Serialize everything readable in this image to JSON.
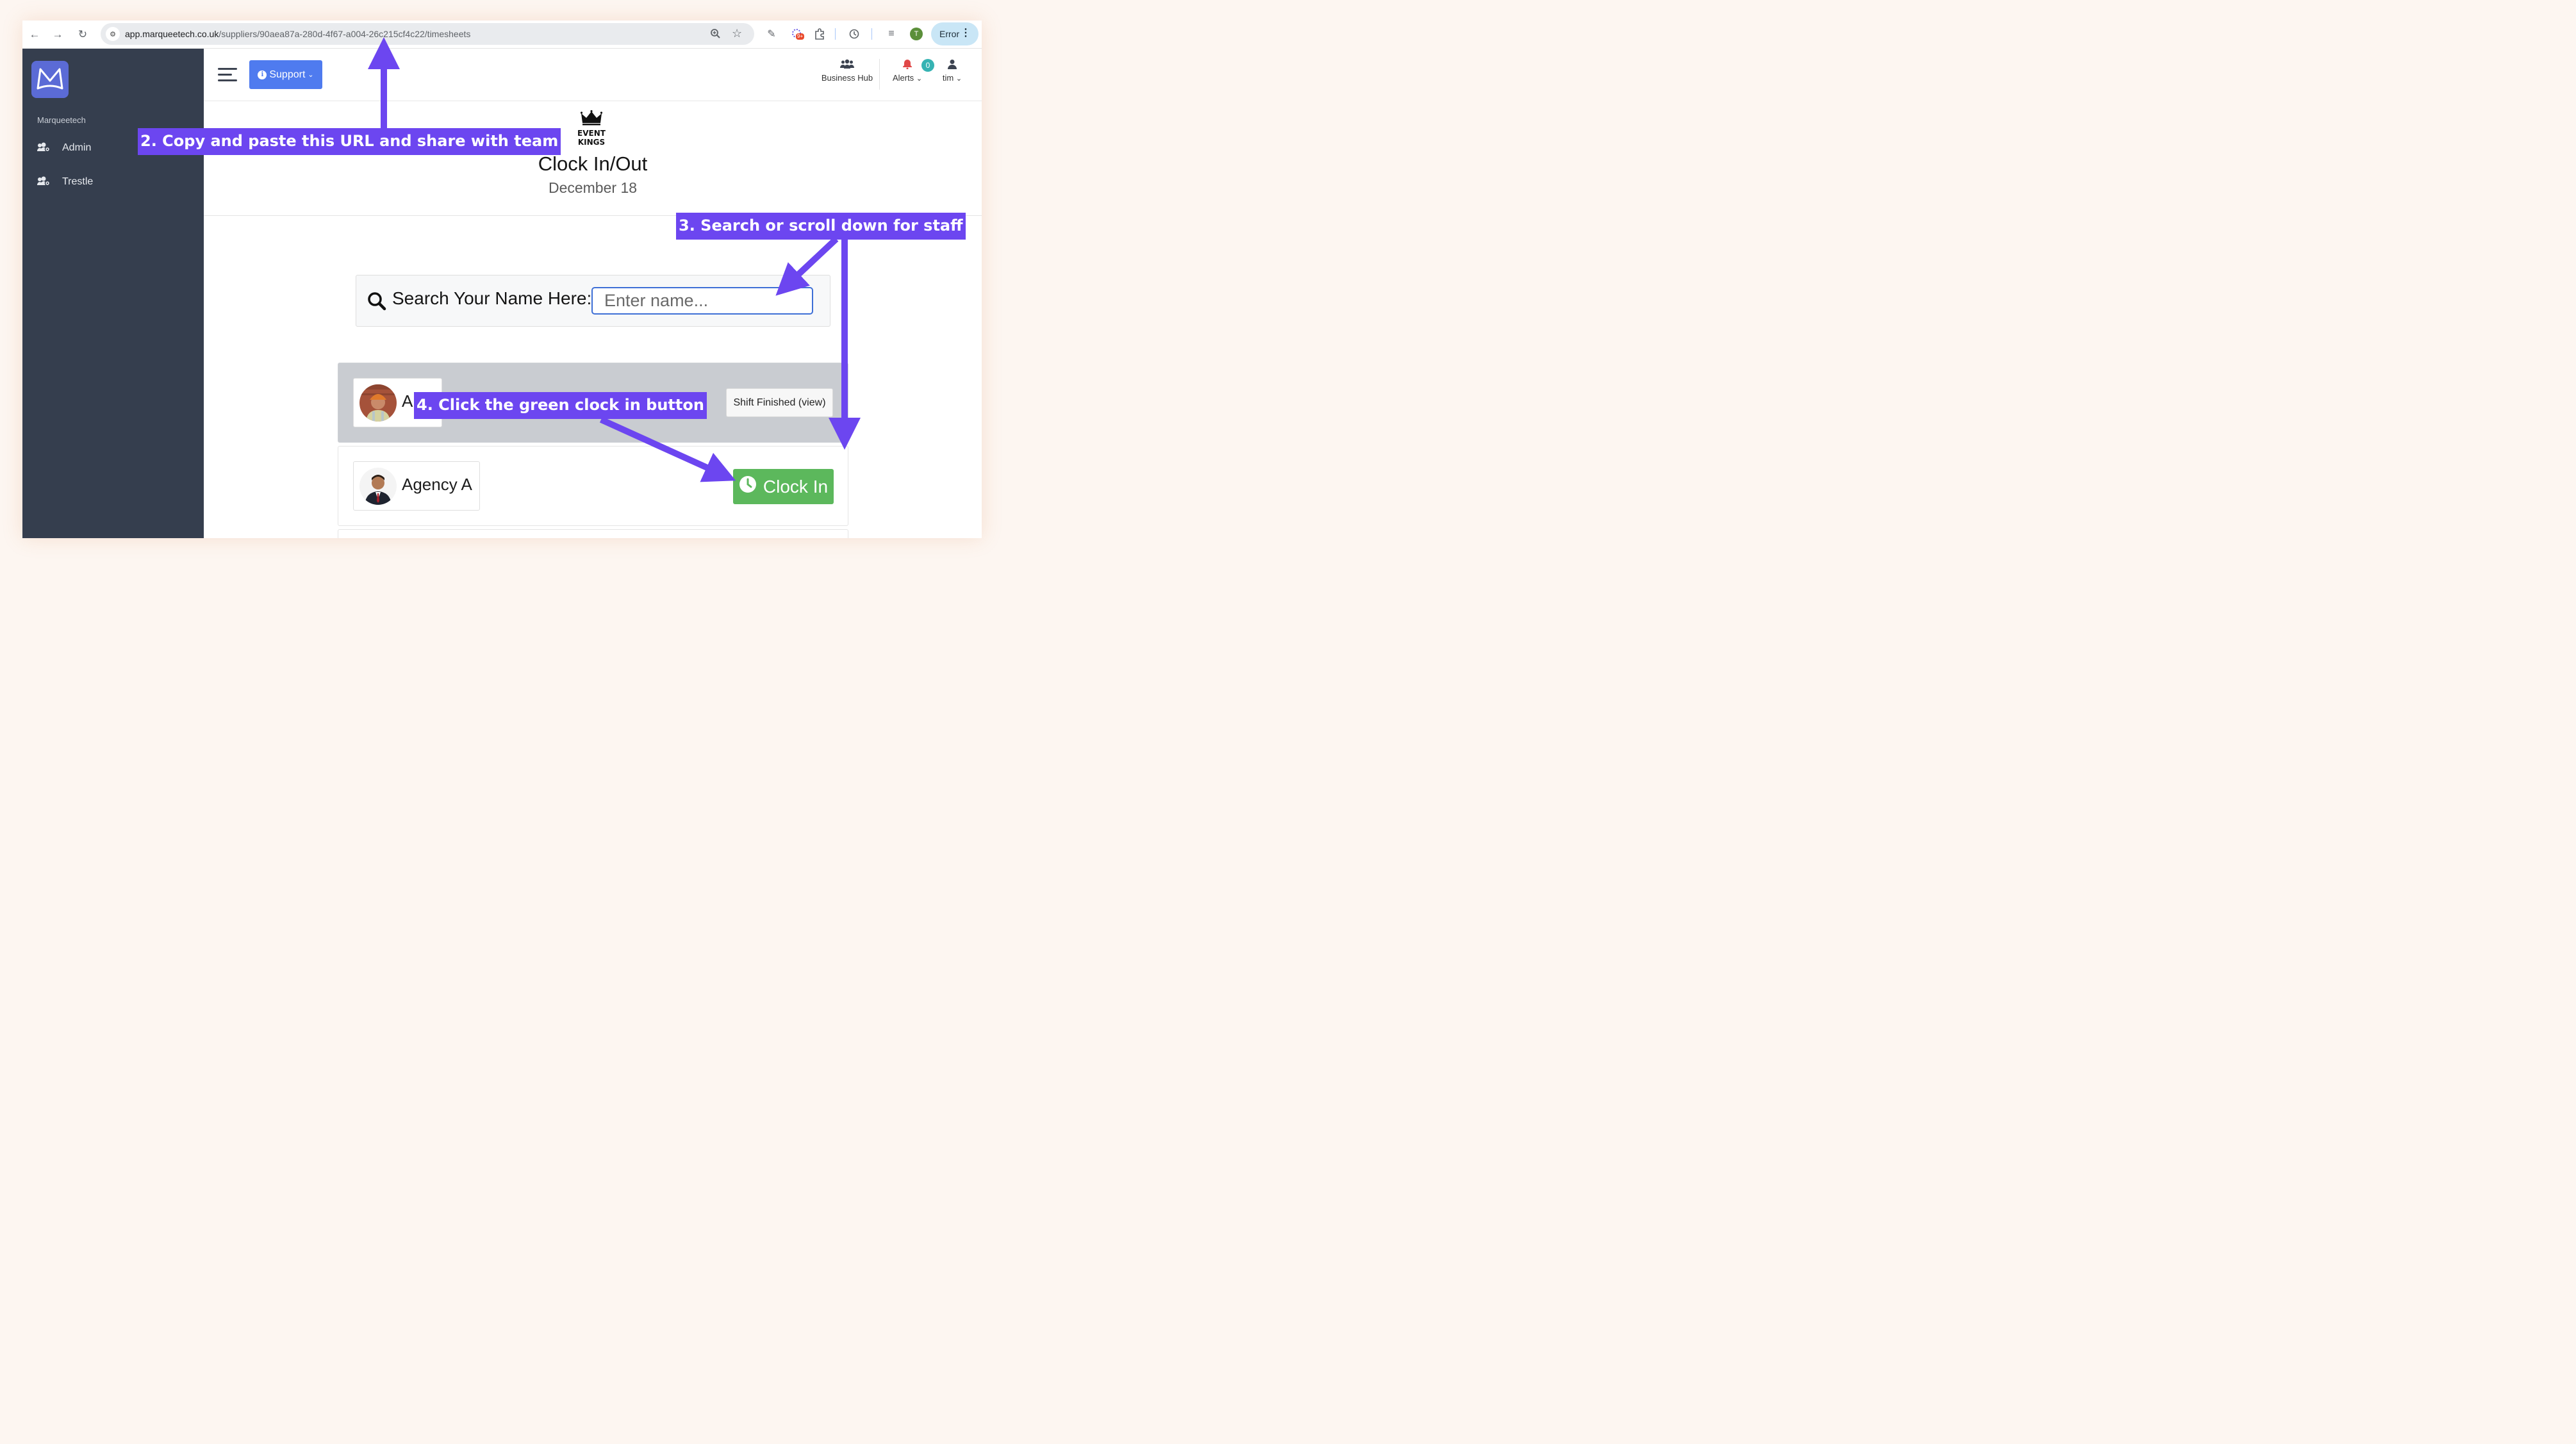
{
  "browser": {
    "url_host": "app.marqueetech.co.uk",
    "url_path": "/suppliers/90aea87a-280d-4f67-a004-26c215cf4c22/timesheets",
    "extension_badge": "9+",
    "profile_initial": "T",
    "error_label": "Error"
  },
  "sidebar": {
    "org_name": "Marqueetech",
    "items": [
      {
        "label": "Admin",
        "icon": "users-cog-icon"
      },
      {
        "label": "Trestle",
        "icon": "users-cog-icon"
      }
    ]
  },
  "header": {
    "support_label": "Support",
    "business_hub_label": "Business Hub",
    "alerts_label": "Alerts",
    "alerts_count": "0",
    "user_label": "tim"
  },
  "main": {
    "brand_line1": "EVENT",
    "brand_line2": "KINGS",
    "title": "Clock In/Out",
    "date": "December 18",
    "search_label": "Search Your Name Here:",
    "search_placeholder": "Enter name...",
    "rows": [
      {
        "name": "A",
        "action": "Shift Finished (view)"
      },
      {
        "name": "Agency A",
        "action": "Clock In"
      }
    ]
  },
  "annotations": {
    "step2": "2. Copy and paste this URL and share with team",
    "step3": "3. Search or scroll down for staff",
    "step4": "4. Click the green clock in button"
  },
  "colors": {
    "accent": "#6c46f0",
    "sidebar": "#353e4e",
    "support": "#4f7bef",
    "clock_in": "#5cb85c"
  }
}
